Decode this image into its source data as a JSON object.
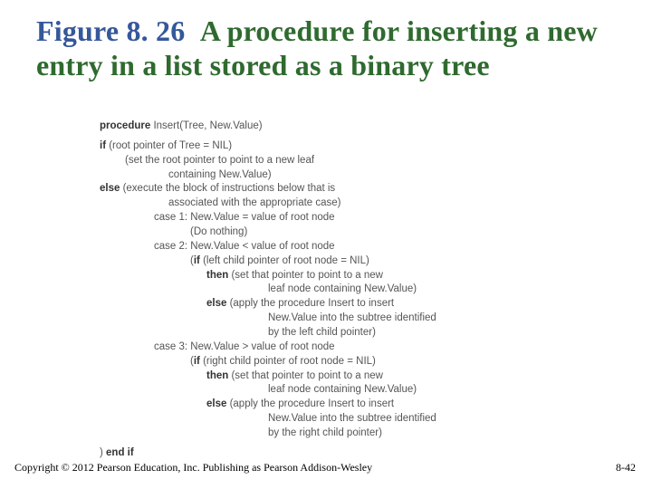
{
  "title": {
    "fig": "Figure 8. 26",
    "rest": "&nbsp;&nbsp;A procedure for inserting a new entry in a list stored as a binary tree"
  },
  "code": {
    "l01a": "procedure",
    "l01b": " Insert(Tree, New.Value)",
    "l02a": "if",
    "l02b": " (root pointer of Tree = NIL)",
    "l03": "(set the root pointer to point to a new leaf",
    "l04": "containing New.Value)",
    "l05a": "else",
    "l05b": " (execute the block of instructions below that is",
    "l06": "associated with the appropriate case)",
    "l07": "case 1: New.Value = value of root node",
    "l08": "(Do nothing)",
    "l09": "case 2: New.Value < value of root node",
    "l10a": "(",
    "l10b": "if",
    "l10c": " (left child pointer of root node = NIL)",
    "l11a": "then",
    "l11b": " (set that pointer to point to a new",
    "l12": "leaf node containing New.Value)",
    "l13a": "else",
    "l13b": " (apply the procedure Insert to insert",
    "l14": "New.Value into the subtree identified",
    "l15": "by the left child pointer)",
    "l16": "case 3: New.Value > value of root node",
    "l17a": "(",
    "l17b": "if",
    "l17c": " (right child pointer of root node = NIL)",
    "l18a": "then",
    "l18b": " (set that pointer to point to a new",
    "l19": "leaf node containing New.Value)",
    "l20a": "else",
    "l20b": " (apply the procedure Insert to insert",
    "l21": "New.Value into the subtree identified",
    "l22": "by the right child pointer)",
    "l23a": ") ",
    "l23b": "end if"
  },
  "footer": {
    "copyright": "Copyright © 2012 Pearson Education, Inc. Publishing as Pearson Addison-Wesley",
    "pagenum": "8-42"
  }
}
